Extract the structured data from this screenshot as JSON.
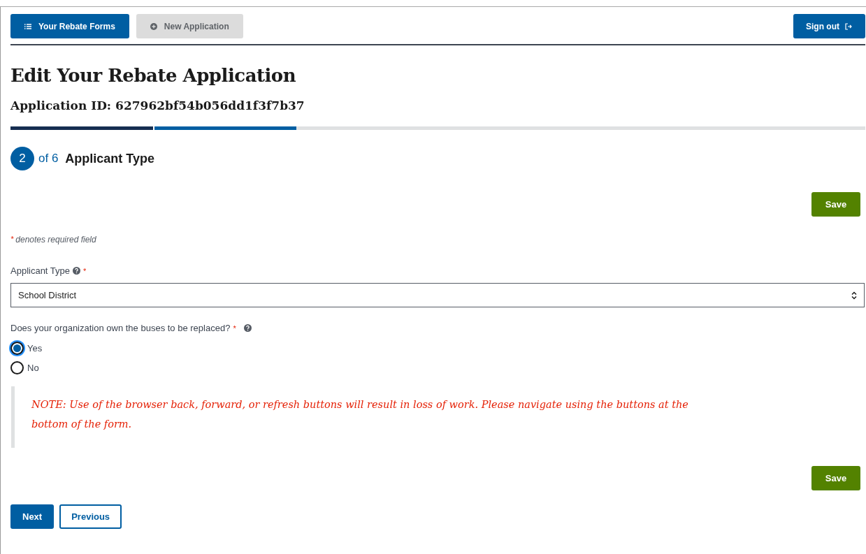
{
  "nav": {
    "buttons": [
      {
        "label": "Your Rebate Forms",
        "disabled": false
      },
      {
        "label": "New Application",
        "disabled": true
      }
    ],
    "sign_out": {
      "label": "Sign out"
    }
  },
  "title": "Edit Your Rebate Application",
  "subtitle": "Application ID: 627962bf54b056dd1f3f7b37",
  "progress": [
    {
      "completed": true,
      "current": false
    },
    {
      "completed": false,
      "current": true
    },
    {
      "completed": false,
      "current": false
    },
    {
      "completed": false,
      "current": false
    },
    {
      "completed": false,
      "current": false
    },
    {
      "completed": false,
      "current": false
    }
  ],
  "step": {
    "number": "2",
    "total": "of 6",
    "name": "Applicant Type"
  },
  "save_top": "Save",
  "required_note": {
    "mark": "*",
    "text": "denotes required field"
  },
  "applicant_type": {
    "label": "Applicant Type",
    "required": true,
    "value": "School District"
  },
  "question": {
    "label": "Does your organization own the buses to be replaced?",
    "required": true,
    "options": [
      {
        "label": "Yes",
        "selected": true
      },
      {
        "label": "No",
        "selected": false
      }
    ]
  },
  "note": "NOTE: Use of the browser back, forward, or refresh buttons will result in loss of work. Please navigate using the buttons at the bottom of the form.",
  "save_bottom": "Save",
  "footer_buttons": [
    {
      "label": "Next",
      "kind": "primary"
    },
    {
      "label": "Previous",
      "kind": "outline"
    }
  ]
}
